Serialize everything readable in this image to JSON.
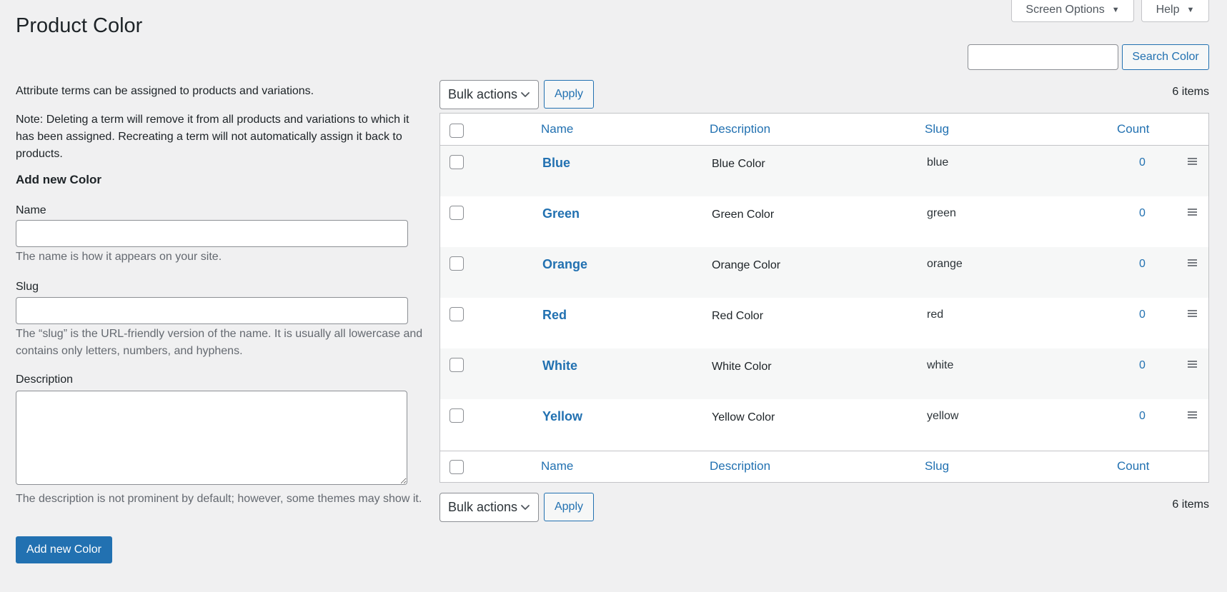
{
  "header": {
    "screen_options_label": "Screen Options",
    "help_label": "Help",
    "page_title": "Product Color"
  },
  "search": {
    "value": "",
    "button_label": "Search Color"
  },
  "form": {
    "intro": "Attribute terms can be assigned to products and variations.",
    "note": "Note: Deleting a term will remove it from all products and variations to which it has been assigned. Recreating a term will not automatically assign it back to products.",
    "title": "Add new Color",
    "name_label": "Name",
    "name_value": "",
    "name_help": "The name is how it appears on your site.",
    "slug_label": "Slug",
    "slug_value": "",
    "slug_help": "The “slug” is the URL-friendly version of the name. It is usually all lowercase and contains only letters, numbers, and hyphens.",
    "description_label": "Description",
    "description_value": "",
    "description_help": "The description is not prominent by default; however, some themes may show it.",
    "submit_label": "Add new Color"
  },
  "list": {
    "bulk_actions_label": "Bulk actions",
    "apply_label": "Apply",
    "items_count": "6 items",
    "columns": {
      "name": "Name",
      "description": "Description",
      "slug": "Slug",
      "count": "Count"
    },
    "rows": [
      {
        "name": "Blue",
        "description": "Blue Color",
        "slug": "blue",
        "count": "0"
      },
      {
        "name": "Green",
        "description": "Green Color",
        "slug": "green",
        "count": "0"
      },
      {
        "name": "Orange",
        "description": "Orange Color",
        "slug": "orange",
        "count": "0"
      },
      {
        "name": "Red",
        "description": "Red Color",
        "slug": "red",
        "count": "0"
      },
      {
        "name": "White",
        "description": "White Color",
        "slug": "white",
        "count": "0"
      },
      {
        "name": "Yellow",
        "description": "Yellow Color",
        "slug": "yellow",
        "count": "0"
      }
    ]
  },
  "colors": {
    "accent": "#2271b1",
    "background": "#f0f0f1"
  },
  "icons": {
    "tab_arrow": "triangle-down-icon",
    "select_chevron": "chevron-down-icon",
    "row_handle": "drag-handle-icon"
  }
}
